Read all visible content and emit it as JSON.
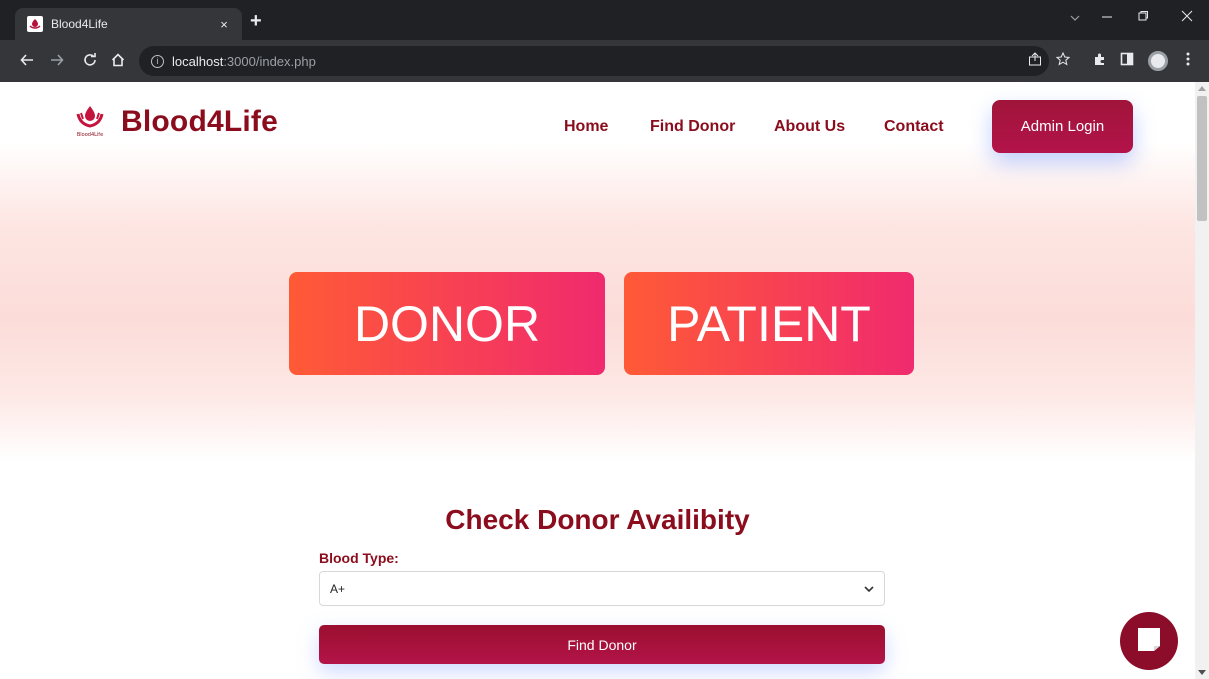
{
  "browser": {
    "tab_title": "Blood4Life",
    "tab_close": "×",
    "new_tab": "+",
    "url_host": "localhost",
    "url_rest": ":3000/index.php",
    "icons": [
      "back-icon",
      "forward-icon",
      "reload-icon",
      "home-icon",
      "info-icon",
      "share-icon",
      "star-icon",
      "extensions-icon",
      "sidepanel-icon",
      "profile-icon",
      "menu-icon"
    ]
  },
  "site": {
    "logo_text": "Blood4Life",
    "logo_small": "Blood4Life",
    "nav": [
      "Home",
      "Find Donor",
      "About Us",
      "Contact"
    ],
    "admin_login": "Admin Login"
  },
  "hero": {
    "donor": "DONOR",
    "patient": "PATIENT"
  },
  "availability": {
    "title": "Check Donor Availibity",
    "label": "Blood Type:",
    "selected": "A+",
    "button": "Find Donor"
  },
  "colors": {
    "brand": "#8b0d1d",
    "button_gradient_start": "#ff5a36",
    "button_gradient_end": "#f02a6e",
    "button_primary": "#a0143a"
  }
}
